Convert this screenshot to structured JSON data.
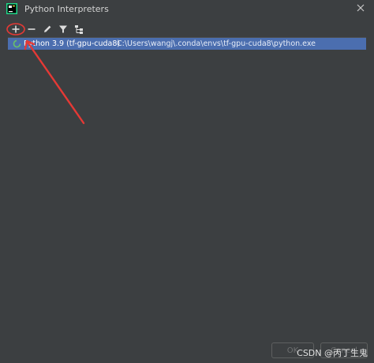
{
  "window": {
    "title": "Python Interpreters"
  },
  "toolbar": {
    "icons": [
      "add-icon",
      "remove-icon",
      "edit-icon",
      "filter-icon",
      "tree-icon"
    ]
  },
  "interpreters": [
    {
      "name": "Python 3.9 (tf-gpu-cuda8)",
      "path": "C:\\Users\\wangj\\.conda\\envs\\tf-gpu-cuda8\\python.exe",
      "selected": true
    }
  ],
  "footer": {
    "ok_label": "OK",
    "cancel_label": "Cancel"
  },
  "watermark": "CSDN @丙丁生鬼",
  "colors": {
    "background": "#3c3f41",
    "selection": "#4b6eaf",
    "annotation": "#e53935"
  }
}
